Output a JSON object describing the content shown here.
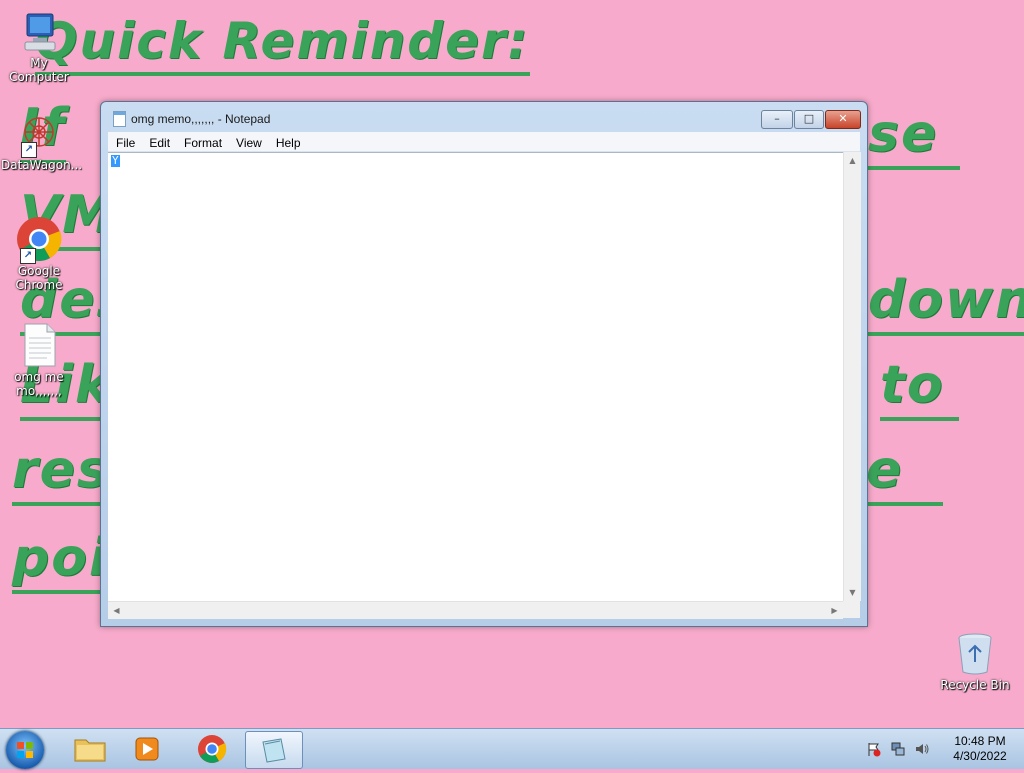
{
  "wallpaper": {
    "lines": [
      "Quick Reminder:",
      "If",
      "se",
      "VM",
      "des",
      "down.",
      "Lik",
      "to",
      "res",
      "e",
      "poi"
    ]
  },
  "desktop_icons": [
    {
      "label": "My Computer",
      "icon": "computer-icon"
    },
    {
      "label": "DataWagon...",
      "icon": "datawagon-icon"
    },
    {
      "label": "Google Chrome",
      "icon": "chrome-icon"
    },
    {
      "label": "omg memo,,,,,,,",
      "icon": "text-file-icon"
    },
    {
      "label": "Recycle Bin",
      "icon": "recycle-bin-icon"
    }
  ],
  "notepad": {
    "title": "omg memo,,,,,,, - Notepad",
    "menu": [
      "File",
      "Edit",
      "Format",
      "View",
      "Help"
    ],
    "content": "Y",
    "buttons": {
      "minimize": "–",
      "maximize": "□",
      "close": "✕"
    }
  },
  "taskbar": {
    "items": [
      "start-orb",
      "windows-explorer",
      "media-player",
      "google-chrome",
      "notepad"
    ],
    "time": "10:48 PM",
    "date": "4/30/2022"
  },
  "colors": {
    "wallpaper": "#f7aacb",
    "wallpaper_text": "#3aa35a",
    "taskbar": "#b9d1ea",
    "window_frame": "#c9dcf1",
    "selection": "#3399ff"
  }
}
